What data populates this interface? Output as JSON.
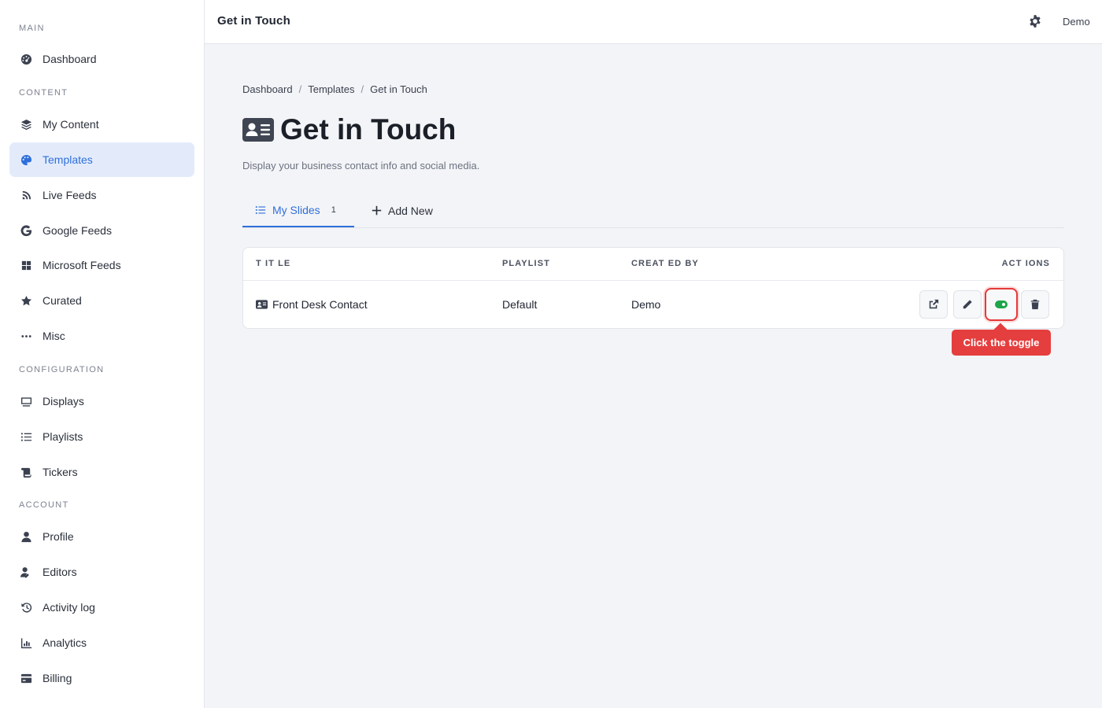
{
  "sidebar": {
    "sections": {
      "main": "MAIN",
      "content": "CONTENT",
      "configuration": "CONFIGURATION",
      "account": "ACCOUNT"
    },
    "items": [
      {
        "label": "Dashboard",
        "icon": "dashboard-icon"
      },
      {
        "label": "My Content",
        "icon": "layers-icon"
      },
      {
        "label": "Templates",
        "icon": "palette-icon",
        "active": true
      },
      {
        "label": "Live Feeds",
        "icon": "satellite-icon"
      },
      {
        "label": "Google Feeds",
        "icon": "google-icon"
      },
      {
        "label": "Microsoft Feeds",
        "icon": "windows-icon"
      },
      {
        "label": "Curated",
        "icon": "star-icon"
      },
      {
        "label": "Misc",
        "icon": "ellipsis-icon"
      },
      {
        "label": "Displays",
        "icon": "monitor-icon"
      },
      {
        "label": "Playlists",
        "icon": "list-icon"
      },
      {
        "label": "Tickers",
        "icon": "scroll-icon"
      },
      {
        "label": "Profile",
        "icon": "user-icon"
      },
      {
        "label": "Editors",
        "icon": "user-edit-icon"
      },
      {
        "label": "Activity log",
        "icon": "history-icon"
      },
      {
        "label": "Analytics",
        "icon": "chart-icon"
      },
      {
        "label": "Billing",
        "icon": "credit-card-icon"
      }
    ]
  },
  "topbar": {
    "title": "Get in Touch",
    "user": "Demo"
  },
  "breadcrumb": [
    "Dashboard",
    "Templates",
    "Get in Touch"
  ],
  "page": {
    "title": "Get in Touch",
    "subtitle": "Display your business contact info and social media."
  },
  "tabs": {
    "my_slides": "My Slides",
    "my_slides_count": "1",
    "add_new": "Add New"
  },
  "table": {
    "headers": {
      "title": "T IT LE",
      "playlist": "PLAYLIST",
      "created_by": "CREAT ED BY",
      "actions": "ACT IONS"
    },
    "rows": [
      {
        "title": "Front Desk Contact",
        "playlist": "Default",
        "created_by": "Demo"
      }
    ]
  },
  "tooltip": "Click the toggle",
  "colors": {
    "accent": "#2f6fdb",
    "active_bg": "#e3ebfb",
    "toggle_on": "#1ea54a",
    "highlight": "#e53e3e"
  }
}
